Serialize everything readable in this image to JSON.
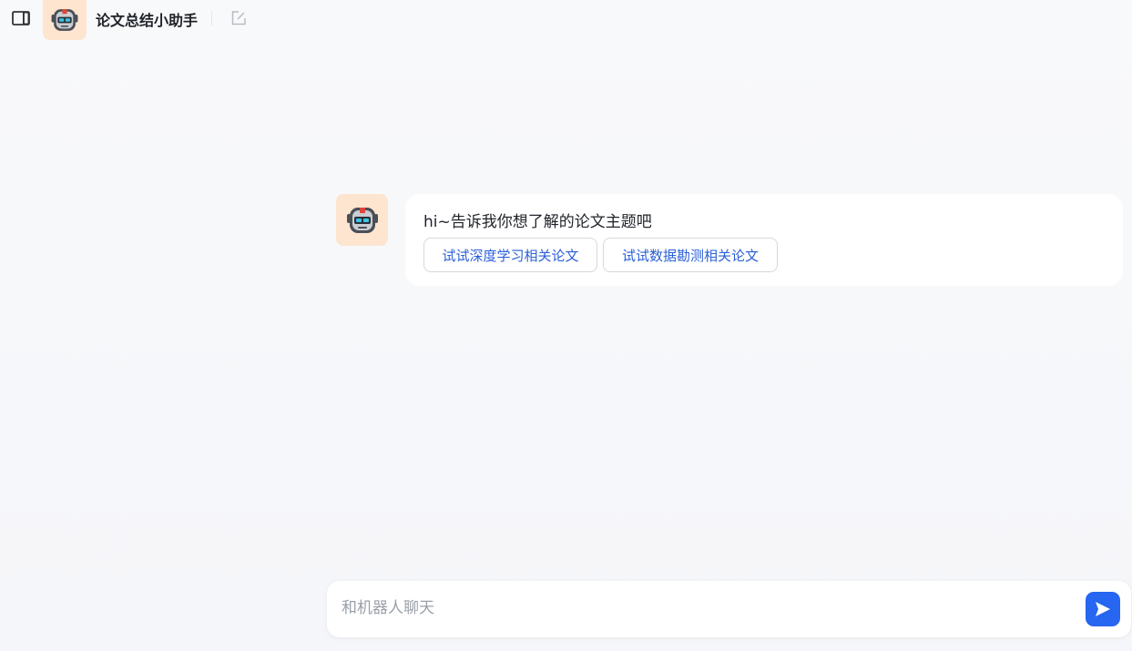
{
  "header": {
    "title": "论文总结小助手",
    "icons": {
      "sidebar_toggle": "sidebar-toggle-icon",
      "avatar": "robot-icon",
      "new_chat": "edit-icon"
    }
  },
  "conversation": {
    "messages": [
      {
        "role": "bot",
        "avatar_icon": "robot-icon",
        "text": "hi~告诉我你想了解的论文主题吧",
        "suggestions": [
          "试试深度学习相关论文",
          "试试数据勘测相关论文"
        ]
      }
    ]
  },
  "composer": {
    "placeholder": "和机器人聊天",
    "value": "",
    "send_icon": "send-icon"
  },
  "colors": {
    "accent": "#2666f0",
    "suggestion_text": "#2a5fd6",
    "avatar_bg": "#fde5d0",
    "background": "#f7f8fa"
  }
}
